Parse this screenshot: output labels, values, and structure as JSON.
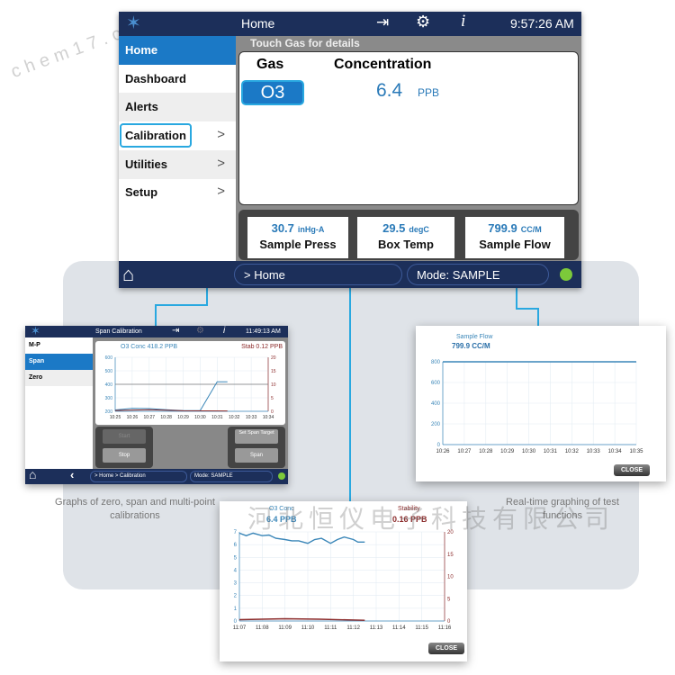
{
  "main": {
    "header": {
      "title": "Home",
      "time": "9:57:26 AM",
      "icons": [
        "logo-icon",
        "sign-in-icon",
        "gear-icon",
        "info-icon"
      ]
    },
    "sidebar": {
      "items": [
        {
          "label": "Home",
          "active": true
        },
        {
          "label": "Dashboard"
        },
        {
          "label": "Alerts"
        },
        {
          "label": "Calibration",
          "chevron": ">"
        },
        {
          "label": "Utilities",
          "chevron": ">"
        },
        {
          "label": "Setup",
          "chevron": ">"
        }
      ]
    },
    "hint": "Touch Gas for details",
    "table": {
      "col_gas": "Gas",
      "col_conc": "Concentration",
      "gas": "O3",
      "value": "6.4",
      "unit": "PPB"
    },
    "tiles": [
      {
        "value": "30.7",
        "unit": "inHg-A",
        "label": "Sample Press"
      },
      {
        "value": "29.5",
        "unit": "degC",
        "label": "Box Temp"
      },
      {
        "value": "799.9",
        "unit": "CC/M",
        "label": "Sample Flow"
      }
    ],
    "footer": {
      "breadcrumb": "> Home",
      "mode": "Mode: SAMPLE",
      "status_color": "#7cc93a"
    }
  },
  "span": {
    "header": {
      "title": "Span Calibration",
      "time": "11:49:13 AM"
    },
    "sidebar": [
      "M-P",
      "Span",
      "Zero"
    ],
    "conc_label": "O3 Conc 418.2 PPB",
    "stab_label": "Stab 0.12 PPB",
    "buttons": {
      "start": "Start",
      "stop": "Stop",
      "set_span": "Set Span Target",
      "span": "Span"
    },
    "footer": {
      "breadcrumb": "> Home > Calibration",
      "mode": "Mode: SAMPLE"
    },
    "caption": "Graphs of zero, span and multi-point calibrations"
  },
  "flow": {
    "title": "Sample Flow",
    "value": "799.9 CC/M",
    "close": "CLOSE",
    "caption": "Real-time graphing of test functions"
  },
  "o3": {
    "conc_title": "O3 Conc",
    "conc_value": "6.4 PPB",
    "stab_title": "Stability",
    "stab_value": "0.16 PPB",
    "close": "CLOSE"
  },
  "watermark": {
    "cn": "河北恒仪电子科技有限公司",
    "web": "chem17.com"
  },
  "colors": {
    "navy": "#1c2f5a",
    "accent": "#29a8e0",
    "blue_series": "#3a86b8",
    "red_series": "#8b2a2a"
  },
  "chart_data": [
    {
      "type": "line",
      "id": "span",
      "xticks": [
        "10:25",
        "10:26",
        "10:27",
        "10:28",
        "10:29",
        "10:30",
        "10:31",
        "10:32",
        "10:33",
        "10:34"
      ],
      "ylim": [
        200,
        600
      ],
      "yticks": [
        200,
        300,
        400,
        500,
        600
      ],
      "y2lim": [
        0,
        20
      ],
      "y2ticks": [
        0,
        5,
        10,
        15,
        20
      ],
      "reference_line": 400,
      "series": [
        {
          "name": "O3 Conc",
          "axis": "left",
          "color": "#3a86b8",
          "points": [
            [
              "10:25",
              210
            ],
            [
              "10:26",
              222
            ],
            [
              "10:27",
              220
            ],
            [
              "10:28",
              212
            ],
            [
              "10:29",
              205
            ],
            [
              "10:30",
              205
            ],
            [
              "10:31",
              418
            ],
            [
              "10:31.6",
              418
            ]
          ]
        },
        {
          "name": "Stab",
          "axis": "right",
          "color": "#8b2a2a",
          "points": [
            [
              "10:25",
              0.3
            ],
            [
              "10:27",
              0.6
            ],
            [
              "10:29",
              0.2
            ],
            [
              "10:31.6",
              0.12
            ]
          ]
        }
      ]
    },
    {
      "type": "line",
      "id": "o3",
      "xticks": [
        "11:07",
        "11:08",
        "11:09",
        "11:10",
        "11:11",
        "11:12",
        "11:13",
        "11:14",
        "11:15",
        "11:16"
      ],
      "ylim": [
        0,
        7
      ],
      "yticks": [
        0,
        1,
        2,
        3,
        4,
        5,
        6,
        7
      ],
      "y2lim": [
        0,
        20
      ],
      "y2ticks": [
        0,
        5,
        10,
        15,
        20
      ],
      "series": [
        {
          "name": "O3 Conc",
          "axis": "left",
          "color": "#3a86b8",
          "points": [
            [
              "11:07",
              6.9
            ],
            [
              "11:07.3",
              6.7
            ],
            [
              "11:07.6",
              6.9
            ],
            [
              "11:08",
              6.7
            ],
            [
              "11:08.3",
              6.75
            ],
            [
              "11:08.6",
              6.5
            ],
            [
              "11:09",
              6.4
            ],
            [
              "11:09.3",
              6.3
            ],
            [
              "11:09.6",
              6.3
            ],
            [
              "11:10",
              6.1
            ],
            [
              "11:10.3",
              6.4
            ],
            [
              "11:10.6",
              6.5
            ],
            [
              "11:11",
              6.1
            ],
            [
              "11:11.3",
              6.4
            ],
            [
              "11:11.6",
              6.6
            ],
            [
              "11:12",
              6.4
            ],
            [
              "11:12.2",
              6.2
            ],
            [
              "11:12.5",
              6.2
            ]
          ]
        },
        {
          "name": "Stability",
          "axis": "right",
          "color": "#8b2a2a",
          "points": [
            [
              "11:07",
              0.3
            ],
            [
              "11:09",
              0.5
            ],
            [
              "11:10.5",
              0.4
            ],
            [
              "11:12.5",
              0.16
            ]
          ]
        }
      ]
    },
    {
      "type": "line",
      "id": "flow",
      "xticks": [
        "10:26",
        "10:27",
        "10:28",
        "10:29",
        "10:30",
        "10:31",
        "10:32",
        "10:33",
        "10:34",
        "10:35"
      ],
      "ylim": [
        0,
        800
      ],
      "yticks": [
        0,
        200,
        400,
        600,
        800
      ],
      "series": [
        {
          "name": "Sample Flow",
          "axis": "left",
          "color": "#3a86b8",
          "points": [
            [
              "10:26",
              799.9
            ],
            [
              "10:35",
              799.9
            ]
          ]
        }
      ]
    }
  ]
}
